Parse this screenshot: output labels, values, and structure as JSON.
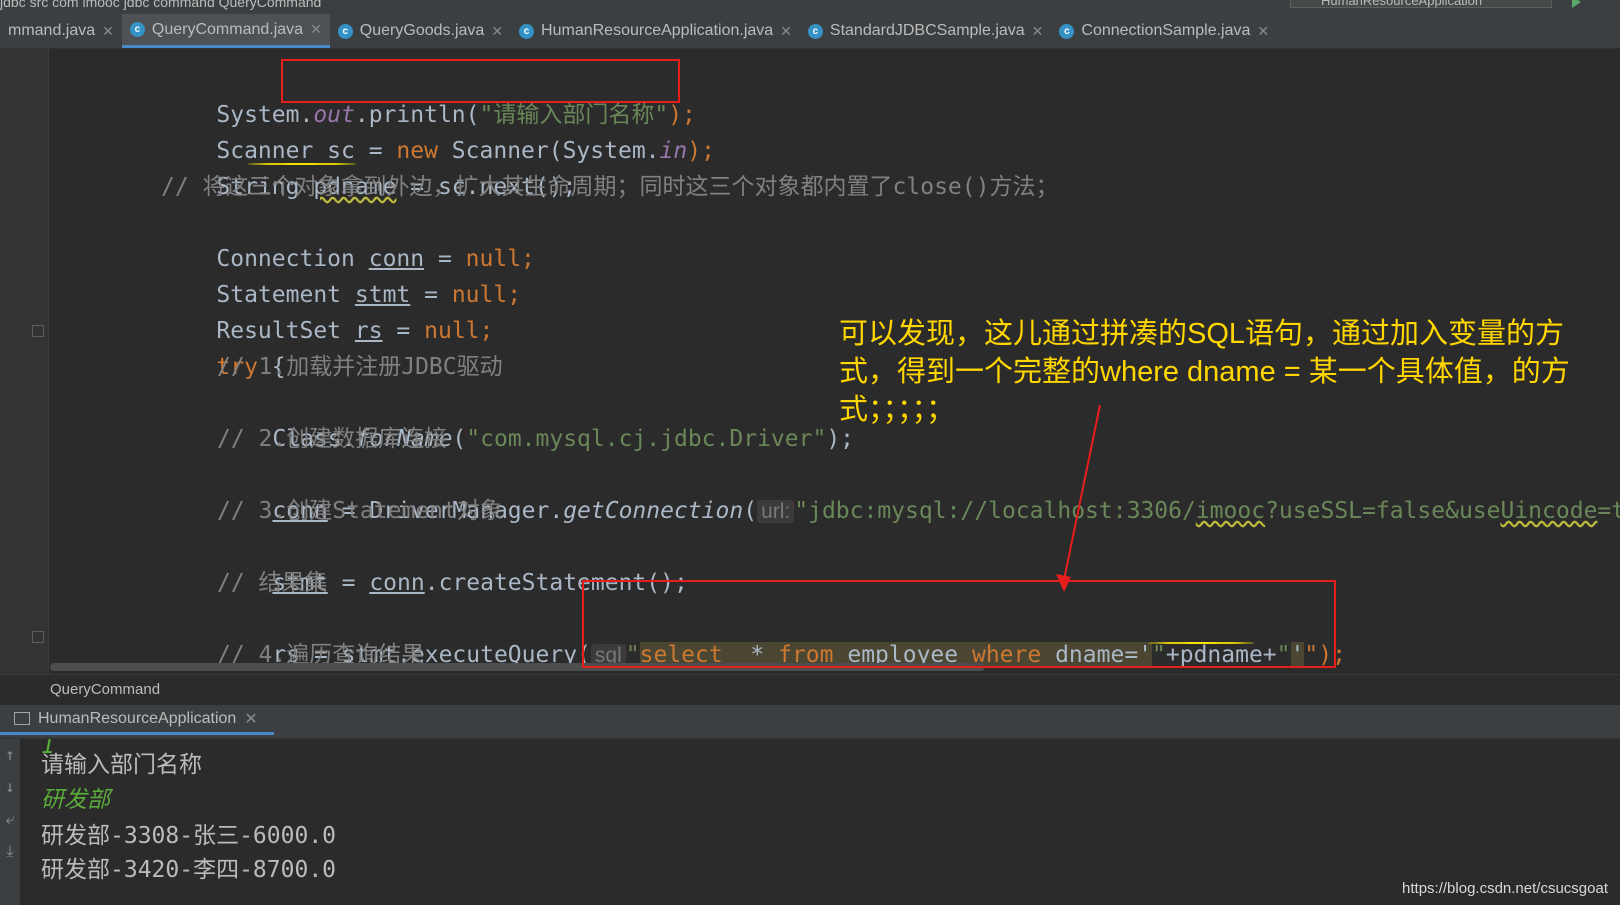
{
  "topbar": {
    "crumbs": "jdbc  src  com  imooc  jdbc  command  QueryCommand",
    "run_config": "HumanResourceApplication"
  },
  "tabs": [
    {
      "label": "mmand.java",
      "icon": "none",
      "active": false
    },
    {
      "label": "QueryCommand.java",
      "icon": "class",
      "active": true
    },
    {
      "label": "QueryGoods.java",
      "icon": "class",
      "active": false
    },
    {
      "label": "HumanResourceApplication.java",
      "icon": "class",
      "active": false
    },
    {
      "label": "StandardJDBCSample.java",
      "icon": "class",
      "active": false
    },
    {
      "label": "ConnectionSample.java",
      "icon": "class",
      "active": false
    }
  ],
  "code": {
    "l1": {
      "a": "System.",
      "b": "out",
      "c": ".println(",
      "d": "\"请输入部门名称\"",
      "e": ");"
    },
    "l2": {
      "a": "Scanner sc = ",
      "b": "new",
      "c": " Scanner(System.",
      "d": "in",
      "e": ");"
    },
    "l3": {
      "a": "String ",
      "b": "pdname",
      "c": " = sc.next();"
    },
    "l4": "// 将这三个对象拿到外边，扩大其生命周期；同时这三个对象都内置了close()方法；",
    "l5": {
      "a": "Connection ",
      "b": "conn",
      "c": " = ",
      "d": "null",
      "e": ";"
    },
    "l6": {
      "a": "Statement ",
      "b": "stmt",
      "c": " = ",
      "d": "null",
      "e": ";"
    },
    "l7": {
      "a": "ResultSet ",
      "b": "rs",
      "c": " = ",
      "d": "null",
      "e": ";"
    },
    "l8": {
      "a": "try",
      "b": " {"
    },
    "l9": "// 1.加载并注册JDBC驱动",
    "l10": {
      "a": "Class.",
      "b": "forName",
      "c": "(",
      "d": "\"com.mysql.cj.jdbc.Driver\"",
      "e": ");"
    },
    "l11": "// 2.创建数据库连接",
    "l12": {
      "a": "conn",
      "b": " = DriverManager.",
      "c": "getConnection",
      "d": "(",
      "hint": "url:",
      "e": "\"jdbc:mysql://localhost:3306/",
      "f": "imooc",
      "g": "?useSSL=false&use",
      "h": "Uincode",
      "i": "=tru"
    },
    "l13": "// 3.创建Statement对象",
    "l14": {
      "a": "stmt",
      "b": " = ",
      "c": "conn",
      "d": ".createStatement();"
    },
    "l15": "// 结果集",
    "l16": {
      "a": "rs",
      "b": " = ",
      "c": "stmt",
      "d": ".executeQuery(",
      "hint": "sql",
      "e": "\"",
      "f": "select",
      "g": "  * ",
      "h": "from",
      "i": " employee ",
      "j": "where",
      "k": " dname='",
      "l": "\"",
      "m": "+pdname+",
      "n": "\"",
      "o": "'",
      "p": "\");"
    },
    "l17": "// 4.遍历查询结果"
  },
  "annotation": "可以发现，这儿通过拼凑的SQL语句，通过加入变量的方式，得到一个完整的where dname = 某一个具体值，的方式；；；；；",
  "breadcrumb": "QueryCommand",
  "run_tab": "HumanResourceApplication",
  "console": {
    "lines": [
      "1",
      "请输入部门名称",
      "研发部",
      "研发部-3308-张三-6000.0",
      "研发部-3420-李四-8700.0"
    ]
  },
  "watermark": "https://blog.csdn.net/csucsgoat",
  "colors": {
    "keyword": "#cc7832",
    "string": "#6a8759",
    "comment": "#808080",
    "annotation": "#ffd600",
    "redbox": "#e81e1e"
  }
}
